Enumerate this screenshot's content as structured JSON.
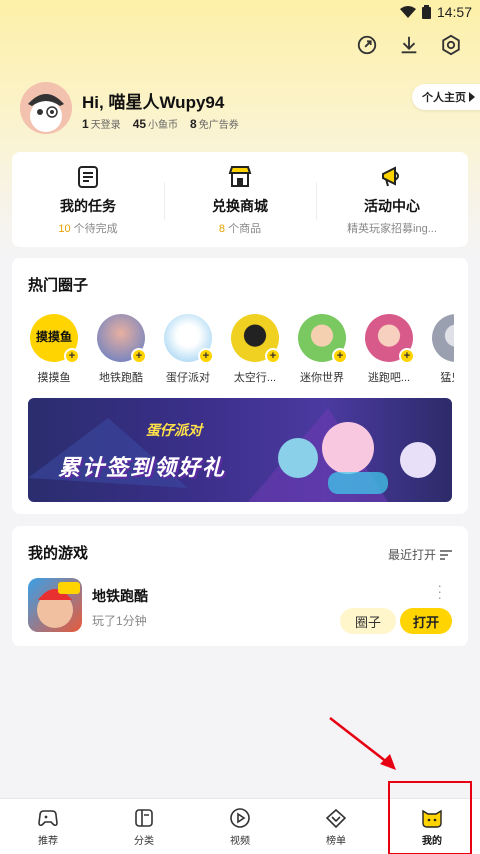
{
  "status": {
    "time": "14:57"
  },
  "profile": {
    "greeting": "Hi, 喵星人Wupy94",
    "home_button": "个人主页",
    "stats": [
      {
        "num": "1",
        "label": "天登录"
      },
      {
        "num": "45",
        "label": "小鱼币"
      },
      {
        "num": "8",
        "label": "免广告券"
      }
    ]
  },
  "quick_actions": [
    {
      "title": "我的任务",
      "sub_num": "10",
      "sub": " 个待完成",
      "icon": "task-list-icon"
    },
    {
      "title": "兑换商城",
      "sub_num": "8",
      "sub": " 个商品",
      "icon": "store-icon"
    },
    {
      "title": "活动中心",
      "sub_num": "",
      "sub": "精英玩家招募ing...",
      "icon": "megaphone-icon"
    }
  ],
  "hot": {
    "title": "热门圈子",
    "circles": [
      {
        "label": "摸摸鱼",
        "icon_text": "摸摸鱼",
        "color": "#ffd400"
      },
      {
        "label": "地铁跑酷",
        "icon_text": "",
        "color": "#5a7ac8"
      },
      {
        "label": "蛋仔派对",
        "icon_text": "",
        "color": "#8ac8f0"
      },
      {
        "label": "太空行...",
        "icon_text": "",
        "color": "#f0d020"
      },
      {
        "label": "迷你世界",
        "icon_text": "",
        "color": "#7ac860"
      },
      {
        "label": "逃跑吧...",
        "icon_text": "",
        "color": "#d85a8a"
      },
      {
        "label": "猛鬼...",
        "icon_text": "",
        "color": "#9aa0b0"
      }
    ],
    "banner_logo": "蛋仔派对",
    "banner_text": "累计签到领好礼"
  },
  "games": {
    "title": "我的游戏",
    "sort_label": "最近打开",
    "items": [
      {
        "name": "地铁跑酷",
        "time": "玩了1分钟",
        "circle_btn": "圈子",
        "open_btn": "打开"
      }
    ]
  },
  "tabs": [
    {
      "label": "推荐",
      "icon": "gamepad-icon"
    },
    {
      "label": "分类",
      "icon": "category-icon"
    },
    {
      "label": "视频",
      "icon": "video-play-icon"
    },
    {
      "label": "榜单",
      "icon": "ranking-icon"
    },
    {
      "label": "我的",
      "icon": "cat-face-icon",
      "active": true
    }
  ]
}
